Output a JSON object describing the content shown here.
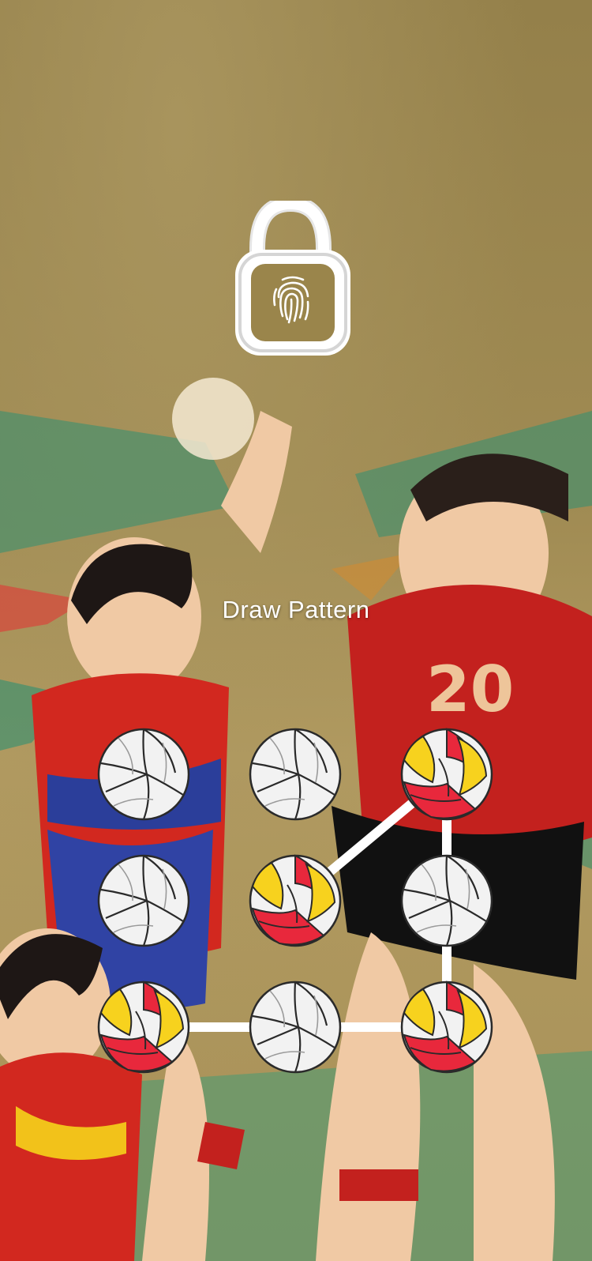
{
  "screen": {
    "title": "Draw Pattern"
  },
  "pattern": {
    "columns": 3,
    "rows": 3,
    "selected_nodes": [
      2,
      4,
      6,
      8
    ],
    "path": [
      6,
      8,
      2,
      4
    ]
  },
  "icons": {
    "lock": "fingerprint-unlock-icon",
    "node": "volleyball-icon",
    "node_selected": "volleyball-selected-icon"
  },
  "colors": {
    "line": "#ffffff",
    "ball_white": "#f2f2f2",
    "ball_red": "#e8283c",
    "ball_yellow": "#f7d21e",
    "ball_outline": "#2a2a2a"
  }
}
